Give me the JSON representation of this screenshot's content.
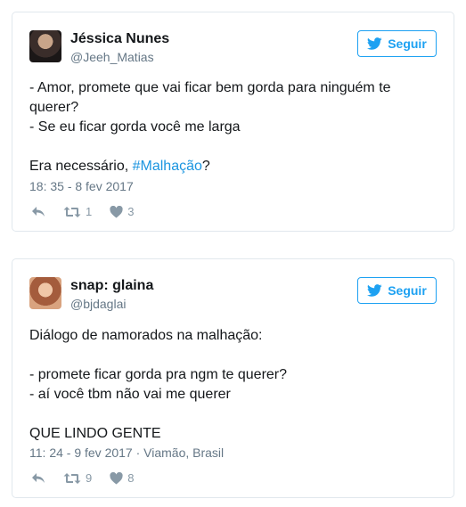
{
  "tweets": [
    {
      "name": "Jéssica Nunes",
      "handle": "@Jeeh_Matias",
      "follow_label": "Seguir",
      "lines": [
        "- Amor, promete que vai ficar bem gorda para ninguém te",
        "querer?",
        "- Se eu ficar gorda você me larga",
        "",
        "Era necessário, "
      ],
      "hashtag": "#Malhação",
      "after_hashtag": "?",
      "meta": "18: 35 - 8 fev 2017",
      "retweets": "1",
      "likes": "3"
    },
    {
      "name": "snap: glaina",
      "handle": "@bjdaglai",
      "follow_label": "Seguir",
      "lines": [
        "Diálogo de namorados na malhação:",
        "",
        "- promete ficar gorda pra ngm te querer?",
        "- aí você tbm não vai me querer",
        "",
        "QUE LINDO GENTE"
      ],
      "meta": "11: 24 - 9 fev 2017 · Viamão, Brasil",
      "retweets": "9",
      "likes": "8"
    }
  ],
  "colors": {
    "accent": "#1da1f2",
    "muted": "#657786",
    "icon": "#8899a6",
    "border": "#e1e8ed"
  },
  "icons": {
    "follow": "twitter-bird-icon",
    "reply": "reply-icon",
    "retweet": "retweet-icon",
    "like": "heart-icon"
  }
}
